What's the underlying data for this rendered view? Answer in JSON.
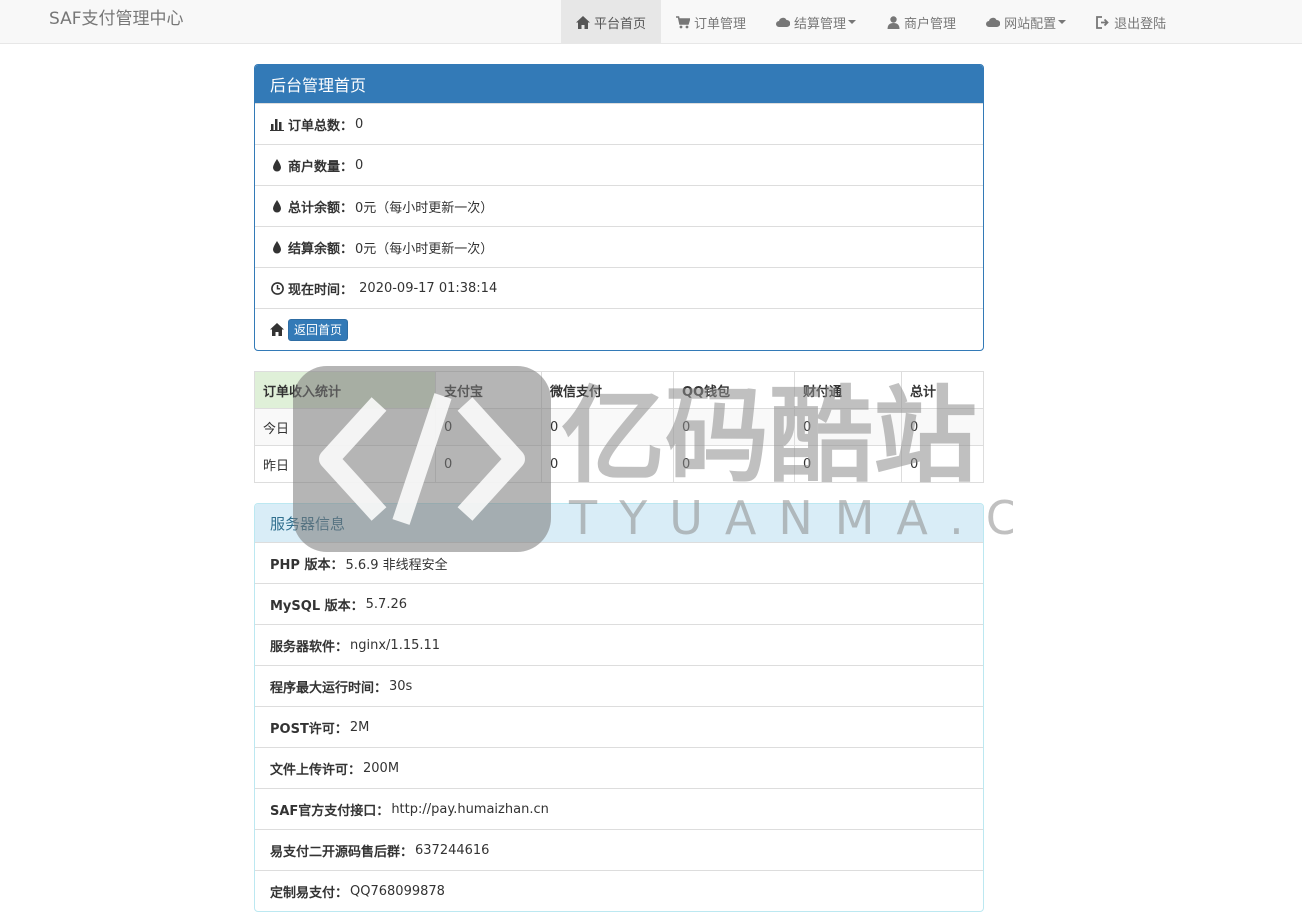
{
  "navbar": {
    "brand": "SAF支付管理中心",
    "items": [
      {
        "label": "平台首页",
        "icon": "home-icon",
        "active": true,
        "caret": false
      },
      {
        "label": "订单管理",
        "icon": "cart-icon",
        "active": false,
        "caret": false
      },
      {
        "label": "结算管理",
        "icon": "cloud-icon",
        "active": false,
        "caret": true
      },
      {
        "label": "商户管理",
        "icon": "user-icon",
        "active": false,
        "caret": false
      },
      {
        "label": "网站配置",
        "icon": "cloud-icon",
        "active": false,
        "caret": true
      },
      {
        "label": "退出登陆",
        "icon": "logout-icon",
        "active": false,
        "caret": false
      }
    ]
  },
  "overview": {
    "title": "后台管理首页",
    "rows": [
      {
        "label": "订单总数：",
        "value": "0",
        "icon": "bar-chart-icon"
      },
      {
        "label": "商户数量：",
        "value": "0",
        "icon": "tint-icon"
      },
      {
        "label": "总计余额：",
        "value": "0元（每小时更新一次）",
        "icon": "tint-icon"
      },
      {
        "label": "结算余额：",
        "value": "0元（每小时更新一次）",
        "icon": "tint-icon"
      },
      {
        "label": "现在时间：",
        "value": " 2020-09-17 01:38:14",
        "icon": "clock-icon"
      }
    ],
    "home_button": "返回首页"
  },
  "stats": {
    "headers": [
      "订单收入统计",
      "支付宝",
      "微信支付",
      "QQ钱包",
      "财付通",
      "总计"
    ],
    "rows": [
      [
        "今日",
        "0",
        "0",
        "0",
        "0",
        "0"
      ],
      [
        "昨日",
        "0",
        "0",
        "0",
        "0",
        "0"
      ]
    ]
  },
  "server": {
    "title": "服务器信息",
    "rows": [
      {
        "label": "PHP 版本：",
        "value": "5.6.9 非线程安全"
      },
      {
        "label": "MySQL 版本：",
        "value": "5.7.26"
      },
      {
        "label": "服务器软件：",
        "value": "nginx/1.15.11"
      },
      {
        "label": "程序最大运行时间：",
        "value": "30s"
      },
      {
        "label": "POST许可：",
        "value": "2M"
      },
      {
        "label": "文件上传许可：",
        "value": "200M"
      },
      {
        "label": "SAF官方支付接口：",
        "value": "http://pay.humaizhan.cn"
      },
      {
        "label": "易支付二开源码售后群：",
        "value": "637244616"
      },
      {
        "label": "定制易支付：",
        "value": "QQ768099878"
      }
    ]
  },
  "watermark": {
    "text": "亿码酷站",
    "subtext": "TYUANMA.CN"
  }
}
